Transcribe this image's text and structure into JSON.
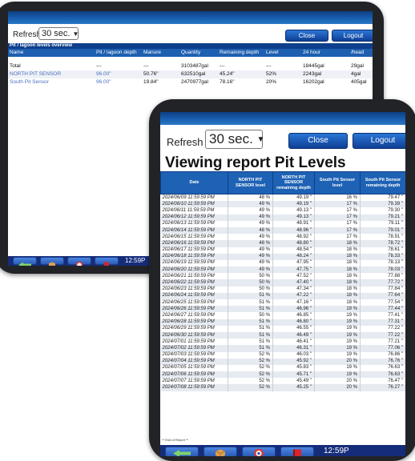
{
  "back": {
    "refresh_label": "Refresh",
    "refresh_value": "30 sec.",
    "close_label": "Close",
    "logout_label": "Logout",
    "section_title": "Pit / lagoon levels overview",
    "columns": [
      "Name",
      "Pit / lagoon depth",
      "Manure",
      "Quantity",
      "Remaining depth",
      "Level",
      "24 hour",
      "/head"
    ],
    "rows": [
      [
        "Total",
        "---",
        "---",
        "3103487gal",
        "---",
        "---",
        "18445gal",
        "29gal"
      ],
      [
        "NORTH PIT SENSOR",
        "96.00\"",
        "50.76\"",
        "632510gal",
        "45.24\"",
        "52%",
        "2243gal",
        "4gal"
      ],
      [
        "South Pit Sensor",
        "96.00\"",
        "19.84\"",
        "2470977gal",
        "78.16\"",
        "20%",
        "16202gal",
        "405gal"
      ]
    ],
    "clock": "12:59P"
  },
  "front": {
    "refresh_label": "Refresh",
    "refresh_value": "30 sec.",
    "close_label": "Close",
    "logout_label": "Logout",
    "title": "Viewing report Pit Levels",
    "columns": [
      "Date",
      "NORTH PIT SENSOR level",
      "NORTH PIT SENSOR remaining depth",
      "South Pit Sensor level",
      "South Pit Sensor remaining depth"
    ],
    "rows": [
      [
        "2024/06/09 11:59:59 PM",
        "48 %",
        "49.19 \"",
        "16 %",
        "79.47 \""
      ],
      [
        "2024/06/10 11:59:59 PM",
        "49 %",
        "49.19 \"",
        "17 %",
        "79.39 \""
      ],
      [
        "2024/06/11 11:59:59 PM",
        "49 %",
        "49.13 \"",
        "17 %",
        "79.30 \""
      ],
      [
        "2024/06/12 11:59:59 PM",
        "49 %",
        "49.13 \"",
        "17 %",
        "79.21 \""
      ],
      [
        "2024/06/13 11:59:59 PM",
        "49 %",
        "48.91 \"",
        "17 %",
        "79.11 \""
      ],
      [
        "2024/06/14 11:59:59 PM",
        "48 %",
        "48.96 \"",
        "17 %",
        "79.01 \""
      ],
      [
        "2024/06/15 11:59:59 PM",
        "49 %",
        "48.92 \"",
        "17 %",
        "78.91 \""
      ],
      [
        "2024/06/16 11:59:59 PM",
        "48 %",
        "48.80 \"",
        "18 %",
        "78.72 \""
      ],
      [
        "2024/06/17 11:59:59 PM",
        "49 %",
        "48.54 \"",
        "18 %",
        "78.61 \""
      ],
      [
        "2024/06/18 11:59:59 PM",
        "49 %",
        "48.24 \"",
        "18 %",
        "78.33 \""
      ],
      [
        "2024/06/19 11:59:59 PM",
        "49 %",
        "47.95 \"",
        "18 %",
        "78.13 \""
      ],
      [
        "2024/06/20 11:59:59 PM",
        "49 %",
        "47.75 \"",
        "18 %",
        "78.03 \""
      ],
      [
        "2024/06/21 11:59:59 PM",
        "50 %",
        "47.52 \"",
        "18 %",
        "77.88 \""
      ],
      [
        "2024/06/22 11:59:59 PM",
        "50 %",
        "47.40 \"",
        "18 %",
        "77.72 \""
      ],
      [
        "2024/06/23 11:59:59 PM",
        "50 %",
        "47.34 \"",
        "18 %",
        "77.84 \""
      ],
      [
        "2024/06/24 11:59:59 PM",
        "51 %",
        "47.22 \"",
        "18 %",
        "77.64 \""
      ],
      [
        "2024/06/25 11:59:59 PM",
        "51 %",
        "47.16 \"",
        "18 %",
        "77.54 \""
      ],
      [
        "2024/06/26 11:59:59 PM",
        "51 %",
        "46.96 \"",
        "19 %",
        "77.44 \""
      ],
      [
        "2024/06/27 11:59:59 PM",
        "50 %",
        "46.85 \"",
        "19 %",
        "77.41 \""
      ],
      [
        "2024/06/28 11:59:59 PM",
        "51 %",
        "46.80 \"",
        "19 %",
        "77.31 \""
      ],
      [
        "2024/06/29 11:59:59 PM",
        "51 %",
        "46.55 \"",
        "19 %",
        "77.22 \""
      ],
      [
        "2024/06/30 11:59:59 PM",
        "51 %",
        "46.49 \"",
        "19 %",
        "77.22 \""
      ],
      [
        "2024/07/01 11:59:59 PM",
        "51 %",
        "46.41 \"",
        "19 %",
        "77.21 \""
      ],
      [
        "2024/07/02 11:59:59 PM",
        "51 %",
        "46.31 \"",
        "19 %",
        "77.06 \""
      ],
      [
        "2024/07/03 11:59:59 PM",
        "52 %",
        "46.03 \"",
        "19 %",
        "76.86 \""
      ],
      [
        "2024/07/04 11:59:59 PM",
        "52 %",
        "45.92 \"",
        "20 %",
        "76.76 \""
      ],
      [
        "2024/07/05 11:59:59 PM",
        "52 %",
        "45.83 \"",
        "19 %",
        "76.63 \""
      ],
      [
        "2024/07/06 11:59:59 PM",
        "52 %",
        "45.71 \"",
        "19 %",
        "76.63 \""
      ],
      [
        "2024/07/07 11:59:59 PM",
        "52 %",
        "45.49 \"",
        "20 %",
        "76.47 \""
      ],
      [
        "2024/07/08 11:59:59 PM",
        "52 %",
        "45.25 \"",
        "20 %",
        "76.27 \""
      ]
    ],
    "end_of_report": "** End of Report **",
    "clock": "12:59P"
  },
  "taskbar_icons": [
    "back-arrow-icon",
    "cube-icon",
    "lifebuoy-icon",
    "book-icon"
  ],
  "colors": {
    "header_blue": "#1e62b5",
    "taskbar_navy": "#152c7a",
    "bezel": "#222327"
  }
}
